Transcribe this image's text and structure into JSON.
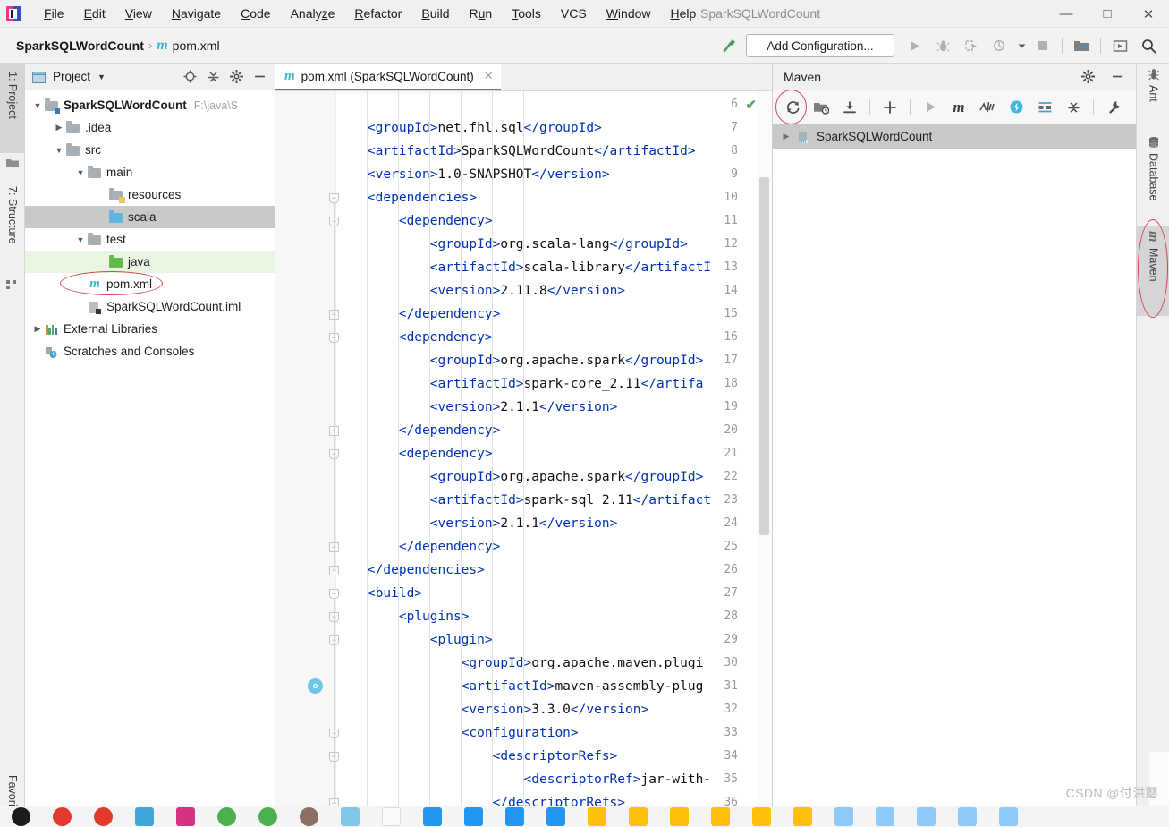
{
  "window": {
    "title": "SparkSQLWordCount",
    "minimize_label": "—",
    "maximize_label": "□",
    "close_label": "✕"
  },
  "menubar": [
    {
      "label": "File"
    },
    {
      "label": "Edit"
    },
    {
      "label": "View"
    },
    {
      "label": "Navigate"
    },
    {
      "label": "Code"
    },
    {
      "label": "Analyze"
    },
    {
      "label": "Refactor"
    },
    {
      "label": "Build"
    },
    {
      "label": "Run"
    },
    {
      "label": "Tools"
    },
    {
      "label": "VCS"
    },
    {
      "label": "Window"
    },
    {
      "label": "Help"
    }
  ],
  "navbar": {
    "project_crumb": "SparkSQLWordCount",
    "separator": "›",
    "file_icon_glyph": "m",
    "file_crumb": "pom.xml",
    "add_configuration_label": "Add Configuration...",
    "icons": [
      "build-hammer-icon",
      "run-icon",
      "debug-icon",
      "run-with-coverage-icon",
      "profiler-icon",
      "stop-icon",
      "project-structure-icon",
      "updates-icon",
      "search-everywhere-icon"
    ]
  },
  "left_strip": {
    "tabs": [
      {
        "label": "1: Project",
        "icon": "project-folder-icon",
        "active": true
      },
      {
        "label": "7: Structure",
        "icon": "structure-icon",
        "active": false
      },
      {
        "label": "Favorites",
        "icon": "favorites-icon",
        "active": false
      }
    ]
  },
  "project_panel": {
    "title": "Project",
    "caret": "▼",
    "actions": [
      "locate-icon",
      "collapse-all-icon",
      "settings-gear-icon",
      "hide-icon"
    ],
    "tree": [
      {
        "depth": 0,
        "arrow": "▼",
        "label": "SparkSQLWordCount",
        "path": "F:\\java\\S",
        "icon": "module-folder-icon",
        "bold": true,
        "state": ""
      },
      {
        "depth": 1,
        "arrow": "▶",
        "label": ".idea",
        "icon": "folder-grey-icon",
        "state": ""
      },
      {
        "depth": 1,
        "arrow": "▼",
        "label": "src",
        "icon": "folder-grey-icon",
        "state": ""
      },
      {
        "depth": 2,
        "arrow": "▼",
        "label": "main",
        "icon": "folder-grey-icon",
        "state": ""
      },
      {
        "depth": 3,
        "arrow": "",
        "label": "resources",
        "icon": "folder-resources-icon",
        "state": ""
      },
      {
        "depth": 3,
        "arrow": "",
        "label": "scala",
        "icon": "folder-source-blue-icon",
        "state": "selected"
      },
      {
        "depth": 2,
        "arrow": "▼",
        "label": "test",
        "icon": "folder-grey-icon",
        "state": ""
      },
      {
        "depth": 3,
        "arrow": "",
        "label": "java",
        "icon": "folder-test-green-icon",
        "state": "green"
      },
      {
        "depth": 2,
        "arrow": "",
        "label": "pom.xml",
        "icon": "maven-file-icon",
        "state": "annotated"
      },
      {
        "depth": 2,
        "arrow": "",
        "label": "SparkSQLWordCount.iml",
        "icon": "iml-file-icon",
        "state": ""
      },
      {
        "depth": 0,
        "arrow": "▶",
        "label": "External Libraries",
        "icon": "libraries-icon",
        "state": ""
      },
      {
        "depth": 0,
        "arrow": "",
        "label": "Scratches and Consoles",
        "icon": "scratches-icon",
        "state": ""
      }
    ]
  },
  "editor": {
    "tab": {
      "icon_glyph": "m",
      "label": "pom.xml (SparkSQLWordCount)",
      "close_glyph": "✕"
    },
    "inspection_status": "✔",
    "first_line": 6,
    "lines": [
      {
        "n": 6,
        "indent": 0,
        "fold": "",
        "tokens": []
      },
      {
        "n": 7,
        "indent": 4,
        "fold": "",
        "tokens": [
          [
            "tg",
            "<groupId>"
          ],
          [
            "tx",
            "net.fhl.sql"
          ],
          [
            "tg",
            "</groupId>"
          ]
        ]
      },
      {
        "n": 8,
        "indent": 4,
        "fold": "",
        "tokens": [
          [
            "tg",
            "<artifactId>"
          ],
          [
            "tx",
            "SparkSQLWordCount"
          ],
          [
            "tg",
            "</artifactId>"
          ]
        ]
      },
      {
        "n": 9,
        "indent": 4,
        "fold": "",
        "tokens": [
          [
            "tg",
            "<version>"
          ],
          [
            "tx",
            "1.0-SNAPSHOT"
          ],
          [
            "tg",
            "</version>"
          ]
        ]
      },
      {
        "n": 10,
        "indent": 4,
        "fold": "pt",
        "tokens": [
          [
            "tg",
            "<dependencies>"
          ]
        ]
      },
      {
        "n": 11,
        "indent": 8,
        "fold": "pt",
        "tokens": [
          [
            "tg",
            "<dependency>"
          ]
        ]
      },
      {
        "n": 12,
        "indent": 12,
        "fold": "",
        "tokens": [
          [
            "tg",
            "<groupId>"
          ],
          [
            "tx",
            "org.scala-lang"
          ],
          [
            "tg",
            "</groupId>"
          ]
        ]
      },
      {
        "n": 13,
        "indent": 12,
        "fold": "",
        "tokens": [
          [
            "tg",
            "<artifactId>"
          ],
          [
            "tx",
            "scala-library"
          ],
          [
            "tg",
            "</artifactI"
          ]
        ]
      },
      {
        "n": 14,
        "indent": 12,
        "fold": "",
        "tokens": [
          [
            "tg",
            "<version>"
          ],
          [
            "tx",
            "2.11.8"
          ],
          [
            "tg",
            "</version>"
          ]
        ]
      },
      {
        "n": 15,
        "indent": 8,
        "fold": "sq",
        "tokens": [
          [
            "tg",
            "</dependency>"
          ]
        ]
      },
      {
        "n": 16,
        "indent": 8,
        "fold": "pt",
        "tokens": [
          [
            "tg",
            "<dependency>"
          ]
        ]
      },
      {
        "n": 17,
        "indent": 12,
        "fold": "",
        "tokens": [
          [
            "tg",
            "<groupId>"
          ],
          [
            "tx",
            "org.apache.spark"
          ],
          [
            "tg",
            "</groupId>"
          ]
        ]
      },
      {
        "n": 18,
        "indent": 12,
        "fold": "",
        "tokens": [
          [
            "tg",
            "<artifactId>"
          ],
          [
            "tx",
            "spark-core_2.11"
          ],
          [
            "tg",
            "</artifa"
          ]
        ]
      },
      {
        "n": 19,
        "indent": 12,
        "fold": "",
        "tokens": [
          [
            "tg",
            "<version>"
          ],
          [
            "tx",
            "2.1.1"
          ],
          [
            "tg",
            "</version>"
          ]
        ]
      },
      {
        "n": 20,
        "indent": 8,
        "fold": "sq",
        "tokens": [
          [
            "tg",
            "</dependency>"
          ]
        ]
      },
      {
        "n": 21,
        "indent": 8,
        "fold": "pt",
        "tokens": [
          [
            "tg",
            "<dependency>"
          ]
        ]
      },
      {
        "n": 22,
        "indent": 12,
        "fold": "",
        "tokens": [
          [
            "tg",
            "<groupId>"
          ],
          [
            "tx",
            "org.apache.spark"
          ],
          [
            "tg",
            "</groupId>"
          ]
        ]
      },
      {
        "n": 23,
        "indent": 12,
        "fold": "",
        "tokens": [
          [
            "tg",
            "<artifactId>"
          ],
          [
            "tx",
            "spark-sql_2.11"
          ],
          [
            "tg",
            "</artifact"
          ]
        ]
      },
      {
        "n": 24,
        "indent": 12,
        "fold": "",
        "tokens": [
          [
            "tg",
            "<version>"
          ],
          [
            "tx",
            "2.1.1"
          ],
          [
            "tg",
            "</version>"
          ]
        ]
      },
      {
        "n": 25,
        "indent": 8,
        "fold": "sq",
        "tokens": [
          [
            "tg",
            "</dependency>"
          ]
        ]
      },
      {
        "n": 26,
        "indent": 4,
        "fold": "sq",
        "tokens": [
          [
            "tg",
            "</dependencies>"
          ]
        ]
      },
      {
        "n": 27,
        "indent": 4,
        "fold": "pt",
        "tokens": [
          [
            "tg",
            "<build>"
          ]
        ]
      },
      {
        "n": 28,
        "indent": 8,
        "fold": "pt",
        "tokens": [
          [
            "tg",
            "<plugins>"
          ]
        ]
      },
      {
        "n": 29,
        "indent": 12,
        "fold": "pt",
        "tokens": [
          [
            "tg",
            "<plugin>"
          ]
        ]
      },
      {
        "n": 30,
        "indent": 16,
        "fold": "",
        "tokens": [
          [
            "tg",
            "<groupId>"
          ],
          [
            "tx",
            "org.apache.maven.plugi"
          ]
        ]
      },
      {
        "n": 31,
        "indent": 16,
        "fold": "run",
        "tokens": [
          [
            "tg",
            "<artifactId>"
          ],
          [
            "tx",
            "maven-assembly-plug"
          ]
        ]
      },
      {
        "n": 32,
        "indent": 16,
        "fold": "",
        "tokens": [
          [
            "tg",
            "<version>"
          ],
          [
            "tx",
            "3.3.0"
          ],
          [
            "tg",
            "</version>"
          ]
        ]
      },
      {
        "n": 33,
        "indent": 16,
        "fold": "pt",
        "tokens": [
          [
            "tg",
            "<configuration>"
          ]
        ]
      },
      {
        "n": 34,
        "indent": 20,
        "fold": "pt",
        "tokens": [
          [
            "tg",
            "<descriptorRefs>"
          ]
        ]
      },
      {
        "n": 35,
        "indent": 24,
        "fold": "",
        "tokens": [
          [
            "tg",
            "<descriptorRef>"
          ],
          [
            "tx",
            "jar-with-"
          ]
        ]
      },
      {
        "n": 36,
        "indent": 20,
        "fold": "sq",
        "tokens": [
          [
            "tg",
            "</descriptorRefs>"
          ]
        ]
      }
    ]
  },
  "maven_panel": {
    "title": "Maven",
    "header_actions": [
      "settings-gear-icon",
      "hide-icon"
    ],
    "toolbar_icons": [
      "reload-all-maven-projects-icon",
      "add-maven-projects-icon",
      "download-sources-icon",
      "add-icon",
      "run-maven-build-icon",
      "execute-maven-goal-icon",
      "toggle-skip-tests-icon",
      "toggle-offline-mode-icon",
      "show-dependencies-icon",
      "collapse-all-icon",
      "maven-settings-icon"
    ],
    "tree": [
      {
        "arrow": "▶",
        "label": "SparkSQLWordCount",
        "icon": "maven-project-icon",
        "selected": true
      }
    ]
  },
  "right_strip": {
    "tabs": [
      {
        "label": "Ant",
        "icon": "ant-icon",
        "active": false
      },
      {
        "label": "Database",
        "icon": "database-icon",
        "active": false
      },
      {
        "label": "Maven",
        "icon": "maven-m-icon",
        "active": true
      }
    ]
  },
  "annotations": {
    "highlight_color": "#d0484c",
    "circled": [
      "pom.xml",
      "reload-all-maven-projects-icon",
      "Maven"
    ]
  },
  "watermark": "CSDN @付洪蘑",
  "colors": {
    "accent_blue": "#4083c9",
    "xml_tag": "#0033b3",
    "xml_text": "#111111",
    "selection_grey": "#c9c9c9",
    "test_green": "#e9f5e1",
    "ok_green": "#59a869"
  }
}
